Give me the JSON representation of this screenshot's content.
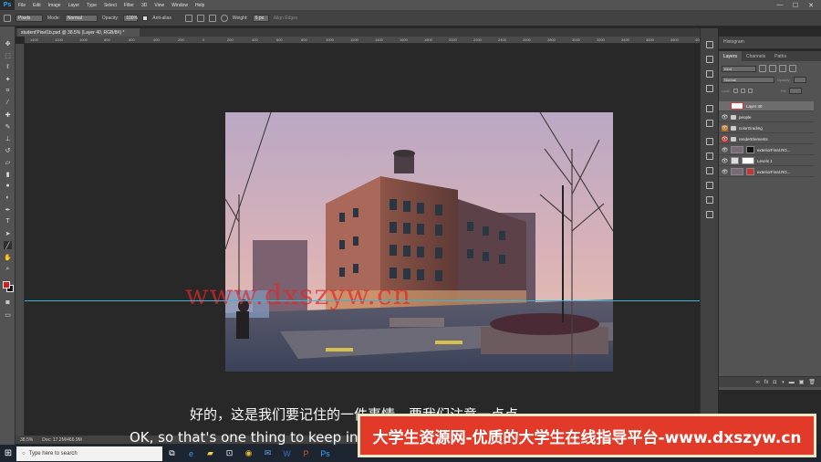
{
  "app": {
    "logo": "Ps"
  },
  "menu": [
    "File",
    "Edit",
    "Image",
    "Layer",
    "Type",
    "Select",
    "Filter",
    "3D",
    "View",
    "Window",
    "Help"
  ],
  "window_controls": {
    "minimize": "—",
    "maximize": "☐",
    "close": "✕"
  },
  "options": {
    "mode_value": "Pixels",
    "blend_label": "Mode:",
    "blend_value": "Normal",
    "opacity_label": "Opacity:",
    "opacity_value": "100%",
    "antialias_label": "Anti-alias",
    "weight_label": "Weight:",
    "weight_value": "6 px",
    "align_edges_label": "Align Edges"
  },
  "document": {
    "tab_title": "student'Pixel1b.psd @ 38.5% (Layer 40, RGB/8#) *",
    "ruler_numbers": [
      "1400",
      "1200",
      "1000",
      "800",
      "600",
      "400",
      "200",
      "0",
      "200",
      "400",
      "600",
      "800",
      "1000",
      "1200",
      "1400",
      "1600",
      "1800",
      "2000",
      "2200",
      "2400",
      "2600",
      "2800",
      "3000",
      "3200",
      "3400",
      "3600",
      "3800",
      "4000"
    ],
    "watermark": "www.dxszyw.cn"
  },
  "status": {
    "zoom": "38.5%",
    "doc_size": "Doc: 17.2M/466.9M"
  },
  "panels": {
    "histogram_tab": "Histogram",
    "tabs": [
      "Layers",
      "Channels",
      "Paths"
    ],
    "filter_label": "Kind",
    "blend_mode": "Normal",
    "opacity_label": "Opacity:",
    "fill_label": "Fill:",
    "lock_label": "Lock:",
    "layers": [
      {
        "name": "Layer 40",
        "type": "pixel"
      },
      {
        "name": "people",
        "type": "group"
      },
      {
        "name": "colorGrading",
        "type": "group"
      },
      {
        "name": "renderElements",
        "type": "group"
      },
      {
        "name": "exteriorFinal.RG...",
        "type": "pixel"
      },
      {
        "name": "Levels 1",
        "type": "adjustment"
      },
      {
        "name": "exteriorFinal.RG...",
        "type": "pixel"
      }
    ],
    "bottom_icons": [
      "link-icon",
      "fx-icon",
      "mask-icon",
      "adjustment-icon",
      "group-icon",
      "new-layer-icon",
      "trash-icon"
    ]
  },
  "subtitles": {
    "cn": "好的，这是我们要记住的一件事情，要我们注意一点点",
    "en": "OK, so that's one thing to keep in mind"
  },
  "banner": "大学生资源网-优质的大学生在线指导平台-www.dxszyw.cn",
  "taskbar": {
    "search_placeholder": "Type here to search",
    "apps": [
      "task-view-icon",
      "edge-icon",
      "explorer-icon",
      "store-icon",
      "chrome-icon",
      "mail-icon",
      "word-icon",
      "powerpoint-icon",
      "photoshop-icon"
    ]
  }
}
